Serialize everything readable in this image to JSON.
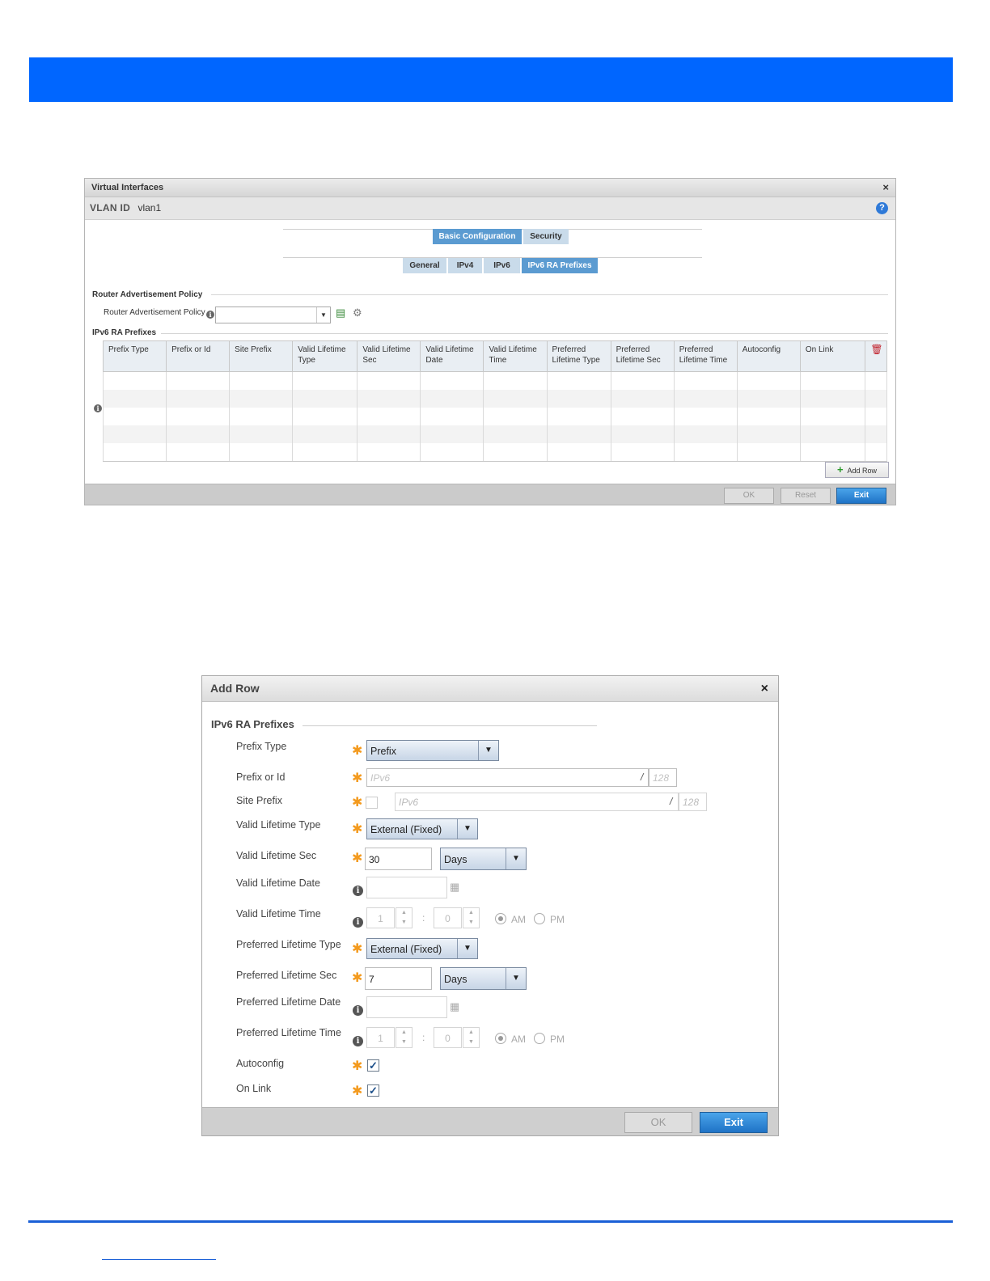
{
  "colors": {
    "header_bar": "#0066ff",
    "tab_active": "#5b9bd1",
    "tab_inactive": "#c9dbea",
    "primary_button": "#1f73c6",
    "required_star": "#f39a1e"
  },
  "vi_window": {
    "title": "Virtual Interfaces",
    "close_icon": "×",
    "vlan_label": "VLAN ID",
    "vlan_value": "vlan1",
    "help_icon": "?",
    "tabs_top": [
      "Basic Configuration",
      "Security"
    ],
    "tabs_sub": [
      "General",
      "IPv4",
      "IPv6",
      "IPv6 RA Prefixes"
    ],
    "active_tab_top": "Basic Configuration",
    "active_tab_sub": "IPv6 RA Prefixes",
    "rap_section": "Router Advertisement Policy",
    "rap_field_label": "Router Advertisement Policy",
    "rap_value": "",
    "prefix_section": "IPv6 RA Prefixes",
    "columns": [
      "Prefix Type",
      "Prefix or Id",
      "Site Prefix",
      "Valid Lifetime Type",
      "Valid Lifetime Sec",
      "Valid Lifetime Date",
      "Valid Lifetime Time",
      "Preferred Lifetime Type",
      "Preferred Lifetime Sec",
      "Preferred Lifetime Time",
      "Autoconfig",
      "On Link"
    ],
    "add_row_label": "Add Row",
    "ok_label": "OK",
    "reset_label": "Reset",
    "exit_label": "Exit"
  },
  "add_row": {
    "title": "Add Row",
    "close_icon": "×",
    "section": "IPv6 RA Prefixes",
    "prefix_type": {
      "label": "Prefix Type",
      "value": "Prefix"
    },
    "prefix_or_id": {
      "label": "Prefix or Id",
      "placeholder": "IPv6",
      "mask": "128"
    },
    "site_prefix": {
      "label": "Site Prefix",
      "placeholder": "IPv6",
      "mask": "128"
    },
    "valid_lifetime_type": {
      "label": "Valid Lifetime Type",
      "value": "External (Fixed)"
    },
    "valid_lifetime_sec": {
      "label": "Valid Lifetime Sec",
      "value": "30",
      "unit": "Days"
    },
    "valid_lifetime_date": {
      "label": "Valid Lifetime Date"
    },
    "valid_lifetime_time": {
      "label": "Valid Lifetime Time",
      "hour": "1",
      "minute": "0",
      "am": "AM",
      "pm": "PM"
    },
    "preferred_lifetime_type": {
      "label": "Preferred Lifetime Type",
      "value": "External (Fixed)"
    },
    "preferred_lifetime_sec": {
      "label": "Preferred Lifetime Sec",
      "value": "7",
      "unit": "Days"
    },
    "preferred_lifetime_date": {
      "label": "Preferred Lifetime Date"
    },
    "preferred_lifetime_time": {
      "label": "Preferred Lifetime Time",
      "hour": "1",
      "minute": "0",
      "am": "AM",
      "pm": "PM"
    },
    "autoconfig": {
      "label": "Autoconfig",
      "checked": true
    },
    "on_link": {
      "label": "On Link",
      "checked": true
    },
    "ok_label": "OK",
    "exit_label": "Exit"
  }
}
